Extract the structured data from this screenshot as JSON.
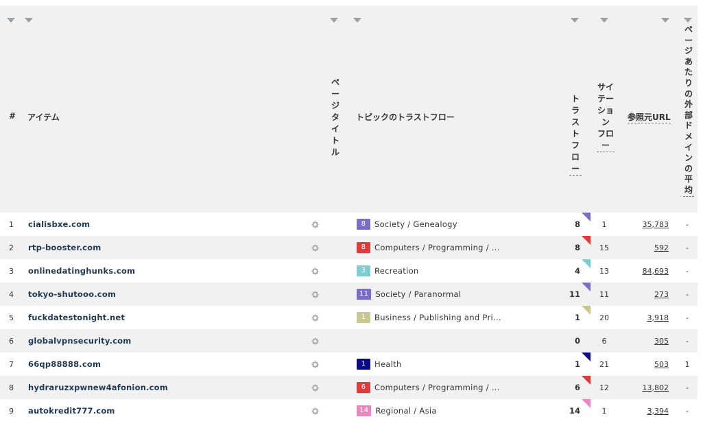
{
  "header": {
    "num": "#",
    "item": "アイテム",
    "page_title": "ページタイトル",
    "topic_tf": "トピックのトラストフロー",
    "trust_flow": "トラストフロー",
    "site_tf": "サイテーションフロー",
    "ref_urls": "参照元URL",
    "avg_ext": "ページあたりの外部ドメインの平均"
  },
  "rows": [
    {
      "num": "1",
      "item": "cialisbxe.com",
      "badge": "8",
      "badge_color": "#7a6dc8",
      "topic": "Society / Genealogy",
      "tf": "8",
      "stf": "1",
      "ref": "35,783",
      "ext": "-"
    },
    {
      "num": "2",
      "item": "rtp-booster.com",
      "badge": "8",
      "badge_color": "#e03b3b",
      "topic": "Computers / Programming / ...",
      "tf": "8",
      "stf": "15",
      "ref": "592",
      "ext": "-"
    },
    {
      "num": "3",
      "item": "onlinedatinghunks.com",
      "badge": "3",
      "badge_color": "#7ecdd0",
      "topic": "Recreation",
      "tf": "4",
      "stf": "13",
      "ref": "84,693",
      "ext": "-"
    },
    {
      "num": "4",
      "item": "tokyo-shutooo.com",
      "badge": "11",
      "badge_color": "#7a6dc8",
      "topic": "Society / Paranormal",
      "tf": "11",
      "stf": "11",
      "ref": "273",
      "ext": "-"
    },
    {
      "num": "5",
      "item": "fuckdatestonight.net",
      "badge": "1",
      "badge_color": "#c9c98f",
      "topic": "Business / Publishing and Pri...",
      "tf": "1",
      "stf": "20",
      "ref": "3,918",
      "ext": "-"
    },
    {
      "num": "6",
      "item": "globalvpnsecurity.com",
      "badge": "",
      "badge_color": "",
      "topic": "",
      "tf": "0",
      "stf": "6",
      "ref": "305",
      "ext": "-"
    },
    {
      "num": "7",
      "item": "66qp88888.com",
      "badge": "1",
      "badge_color": "#0a0a8a",
      "topic": "Health",
      "tf": "1",
      "stf": "21",
      "ref": "503",
      "ext": "1"
    },
    {
      "num": "8",
      "item": "hydraruzxpwnew4afonion.com",
      "badge": "6",
      "badge_color": "#e03b3b",
      "topic": "Computers / Programming / ...",
      "tf": "6",
      "stf": "12",
      "ref": "13,802",
      "ext": "-"
    },
    {
      "num": "9",
      "item": "autokredit777.com",
      "badge": "14",
      "badge_color": "#e88ac0",
      "topic": "Regional / Asia",
      "tf": "14",
      "stf": "1",
      "ref": "3,394",
      "ext": "-"
    }
  ],
  "icons": {
    "gear": "gear-icon",
    "sort": "chevron-down-icon"
  }
}
